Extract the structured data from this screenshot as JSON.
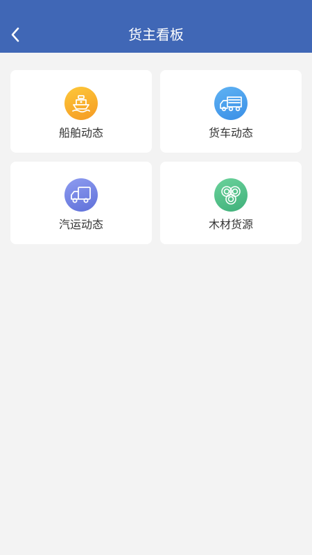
{
  "header": {
    "title": "货主看板",
    "back_icon": "chevron-left-icon"
  },
  "colors": {
    "header_bg": "#4067b6",
    "page_bg": "#f3f3f3",
    "card_bg": "#ffffff",
    "label_text": "#333333"
  },
  "cards": [
    {
      "label": "船舶动态",
      "icon": "ship-icon",
      "color": "#f9b52c"
    },
    {
      "label": "货车动态",
      "icon": "truck-icon",
      "color": "#4aa3ee"
    },
    {
      "label": "汽运动态",
      "icon": "van-icon",
      "color": "#7585e4"
    },
    {
      "label": "木材货源",
      "icon": "timber-icon",
      "color": "#55c08a"
    }
  ]
}
